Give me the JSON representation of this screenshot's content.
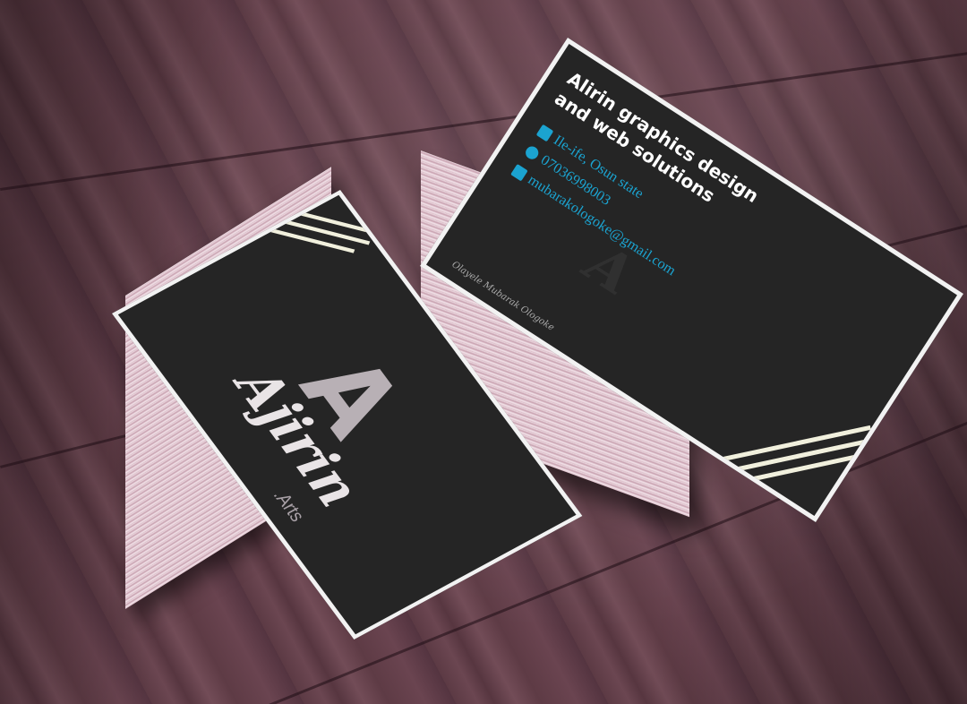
{
  "back_card": {
    "company_line1": "Alirin graphics design",
    "company_line2": "and web solutions",
    "address": "Ile-ife, Osun state",
    "phone": "07036998003",
    "email": "mubarakologoke@gmail.com",
    "signature": "Olayele Mubarak Ologoke",
    "icons": [
      "location-icon",
      "phone-icon",
      "email-icon"
    ],
    "accent_color": "#1ba3d0"
  },
  "front_card": {
    "logo_script": "Ajirin",
    "logo_suffix": "Arts",
    "logo_letter": "A"
  },
  "colors": {
    "card_background": "#252525",
    "stripes": "#f1f0dd",
    "table_wood": "#6b4651"
  }
}
